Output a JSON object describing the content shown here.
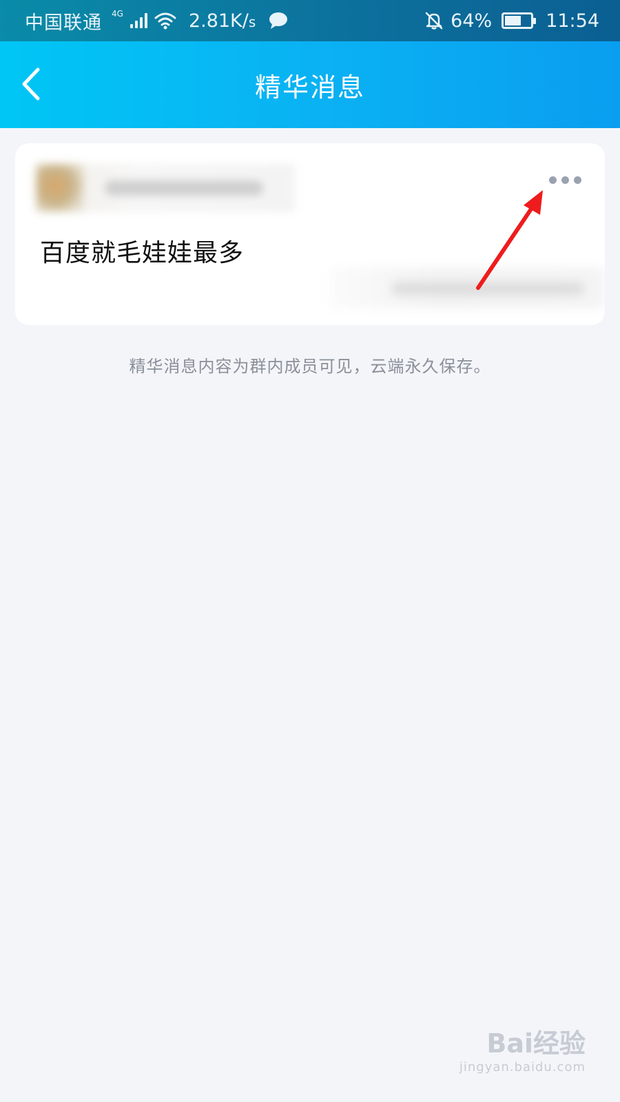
{
  "status_bar": {
    "carrier": "中国联通",
    "network_type": "4G",
    "speed_value": "2.81K/",
    "speed_unit": "s",
    "battery": "64%",
    "battery_level": 0.64,
    "time": "11:54",
    "icons": [
      "signal-icon",
      "wifi-icon",
      "chat-icon",
      "bell-off-icon",
      "battery-icon"
    ]
  },
  "header": {
    "title": "精华消息",
    "back_icon": "chevron-left-icon"
  },
  "card": {
    "message": "百度就毛娃娃最多",
    "more_icon": "more-horizontal-icon"
  },
  "info_note": "精华消息内容为群内成员可见，云端永久保存。",
  "watermark": {
    "logo": "Bai经验",
    "url": "jingyan.baidu.com"
  },
  "colors": {
    "header_start": "#00c6f5",
    "header_end": "#0a9ef0",
    "background": "#f3f5f9",
    "arrow": "#ee1c1c"
  }
}
